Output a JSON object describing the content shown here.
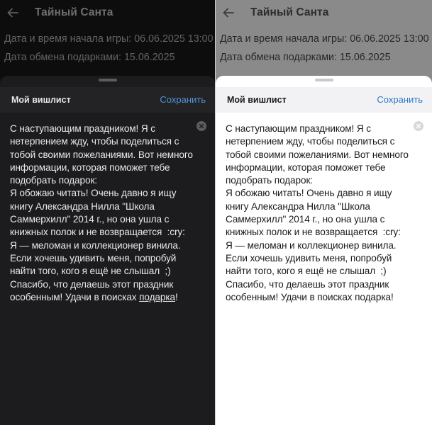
{
  "app": {
    "title": "Тайный Санта"
  },
  "game_info": {
    "start_label": "Дата и время начала игры:",
    "start_value": "06.06.2025 13:00",
    "exchange_label": "Дата обмена подарками:",
    "exchange_value": "15.06.2025"
  },
  "sheet": {
    "title": "Мой вишлист",
    "save_label": "Сохранить"
  },
  "wishlist": {
    "text_main": "С наступающим праздником! Я с нетерпением жду, чтобы поделиться с тобой своими пожеланиями. Вот немного информации, которая поможет тебе подобрать подарок:\nЯ обожаю читать! Очень давно я ищу книгу Александра Нилла \"Школа Саммерхилл\" 2014 г., но она ушла с книжных полок и не возвращается  :cry:\nЯ — меломан и коллекционер винила. Если хочешь удивить меня, попробуй найти того, кого я ещё не слышал  ;)\nСпасибо, что делаешь этот праздник особенным! Удачи в поисках ",
    "last_word": "подарка",
    "end_punct": "!"
  },
  "icons": {
    "back": "arrow-left-icon",
    "clear": "clear-circle-icon"
  },
  "colors": {
    "dark_sheet": "#1c1c1e",
    "light_sheet": "#ffffff",
    "accent_dark": "#4f94d6",
    "accent_light": "#2d7ac8"
  }
}
